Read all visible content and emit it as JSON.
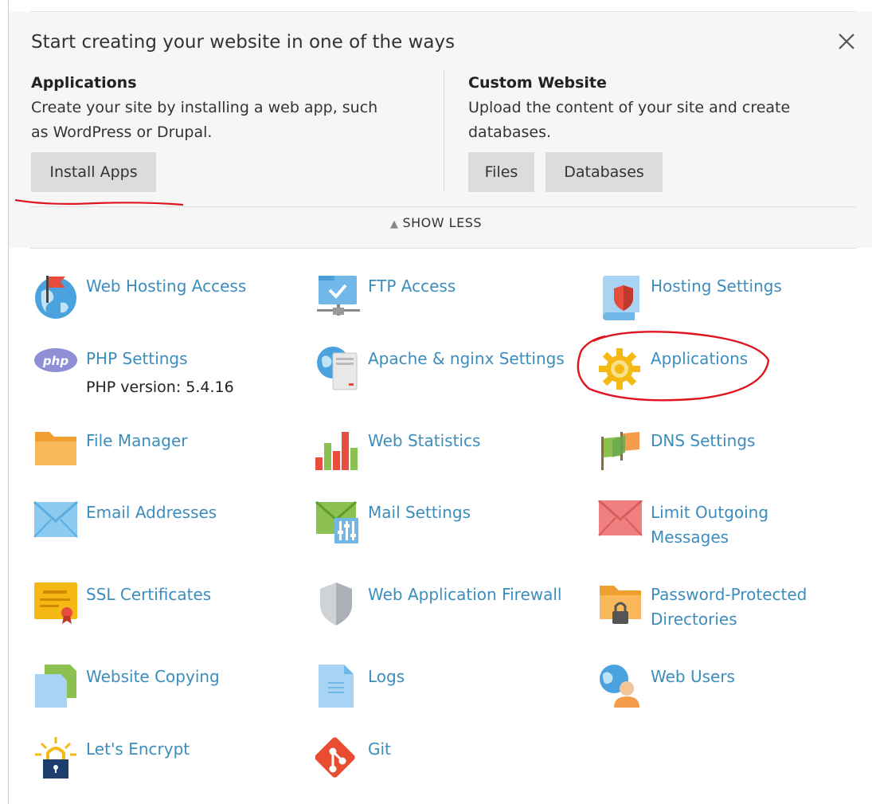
{
  "panel": {
    "title": "Start creating your website in one of the ways",
    "applications": {
      "heading": "Applications",
      "desc1": "Create your site by installing a web app, such",
      "desc2": "as WordPress or Drupal.",
      "button": "Install Apps"
    },
    "custom": {
      "heading": "Custom Website",
      "desc1": "Upload the content of your site and create",
      "desc2": "databases.",
      "files_button": "Files",
      "databases_button": "Databases"
    },
    "show_less": "SHOW LESS"
  },
  "tools": {
    "web_hosting_access": "Web Hosting Access",
    "ftp_access": "FTP Access",
    "hosting_settings": "Hosting Settings",
    "php_settings": "PHP Settings",
    "php_version": "PHP version: 5.4.16",
    "apache_nginx": "Apache & nginx Settings",
    "applications": "Applications",
    "file_manager": "File Manager",
    "web_statistics": "Web Statistics",
    "dns_settings": "DNS Settings",
    "email_addresses": "Email Addresses",
    "mail_settings": "Mail Settings",
    "limit_outgoing_1": "Limit Outgoing",
    "limit_outgoing_2": "Messages",
    "ssl_certificates": "SSL Certificates",
    "waf": "Web Application Firewall",
    "password_dirs_1": "Password-Protected",
    "password_dirs_2": "Directories",
    "website_copying": "Website Copying",
    "logs": "Logs",
    "web_users": "Web Users",
    "lets_encrypt": "Let's Encrypt",
    "git": "Git"
  },
  "colors": {
    "link": "#3c8dbc",
    "annotation": "#e0141e",
    "button_bg": "#dcdcdc"
  }
}
